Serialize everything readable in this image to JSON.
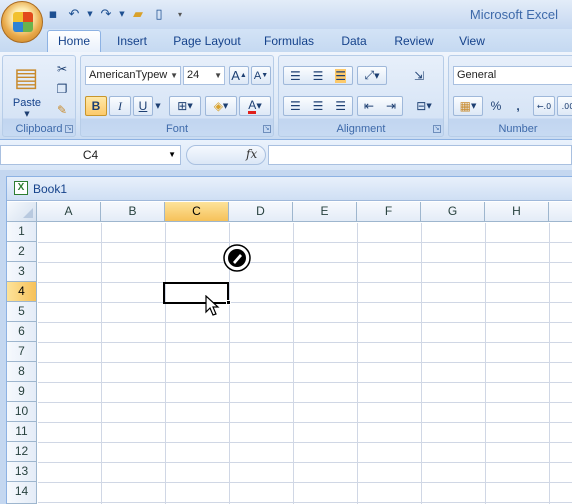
{
  "app": {
    "title": "Microsoft Excel"
  },
  "quick_access": {
    "save_icon": "save-icon",
    "undo_icon": "undo-icon",
    "redo_icon": "redo-icon",
    "open_icon": "open-icon",
    "new_icon": "new-icon",
    "customize_icon": "customize-qat-icon"
  },
  "tabs": [
    {
      "label": "Home",
      "active": true
    },
    {
      "label": "Insert"
    },
    {
      "label": "Page Layout"
    },
    {
      "label": "Formulas"
    },
    {
      "label": "Data"
    },
    {
      "label": "Review"
    },
    {
      "label": "View"
    }
  ],
  "ribbon": {
    "clipboard": {
      "label": "Clipboard",
      "paste_label": "Paste"
    },
    "font": {
      "label": "Font",
      "font_name": "AmericanTypew",
      "font_size": "24",
      "bold": "B",
      "italic": "I",
      "underline": "U",
      "font_color_glyph": "A"
    },
    "alignment": {
      "label": "Alignment"
    },
    "number": {
      "label": "Number",
      "format": "General",
      "percent": "%",
      "comma": ","
    }
  },
  "formula_bar": {
    "name_box": "C4",
    "fx_label": "fx",
    "formula": ""
  },
  "workbook": {
    "name": "Book1",
    "columns": [
      "A",
      "B",
      "C",
      "D",
      "E",
      "F",
      "G",
      "H"
    ],
    "rows": [
      "1",
      "2",
      "3",
      "4",
      "5",
      "6",
      "7",
      "8",
      "9",
      "10",
      "11",
      "12",
      "13",
      "14"
    ],
    "selected_column": "C",
    "selected_row": "4",
    "active_cell": "C4"
  },
  "colors": {
    "accent": "#15428b",
    "selected_header": "#f6c15a"
  }
}
